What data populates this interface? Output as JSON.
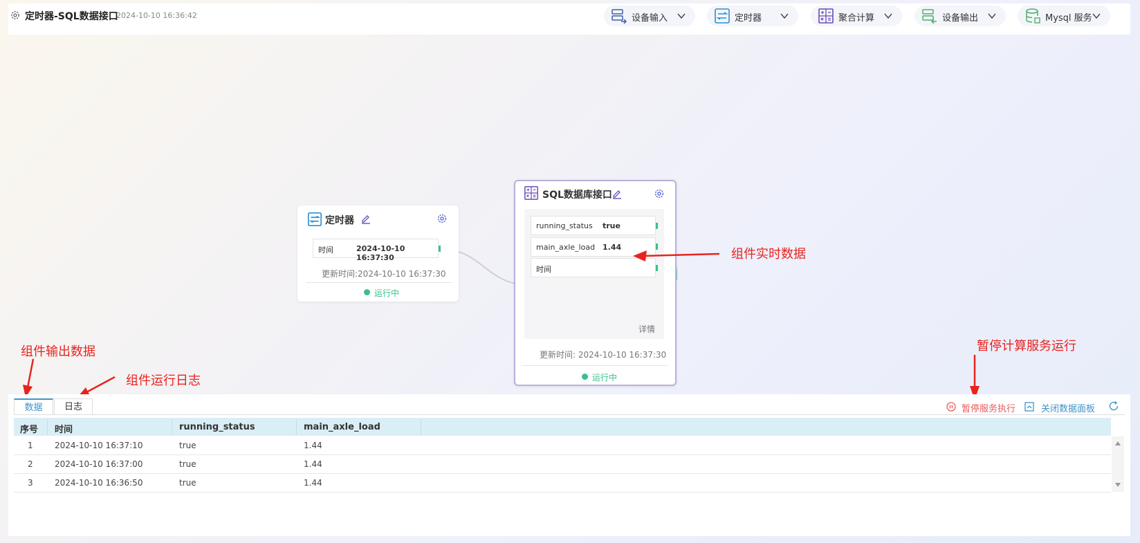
{
  "header": {
    "title": "定时器-SQL数据接口",
    "timestamp": "2024-10-10 16:36:42",
    "toolbar": [
      {
        "label": "设备输入",
        "icon": "device-input-icon"
      },
      {
        "label": "定时器",
        "icon": "timer-icon"
      },
      {
        "label": "聚合计算",
        "icon": "calc-icon"
      },
      {
        "label": "设备输出",
        "icon": "device-output-icon"
      },
      {
        "label": "Mysql 服务",
        "icon": "database-icon"
      }
    ]
  },
  "canvas": {
    "timer_node": {
      "title": "定时器",
      "field_label": "时间",
      "field_value": "2024-10-10 16:37:30",
      "updated": "更新时间:2024-10-10 16:37:30",
      "status": "运行中"
    },
    "sql_node": {
      "title": "SQL数据库接口",
      "fields": [
        {
          "key": "running_status",
          "value": "true"
        },
        {
          "key": "main_axle_load",
          "value": "1.44"
        },
        {
          "key": "时间",
          "value": ""
        }
      ],
      "details": "详情",
      "updated": "更新时间: 2024-10-10 16:37:30",
      "status": "运行中"
    }
  },
  "annotations": {
    "realtime": "组件实时数据",
    "output": "组件输出数据",
    "log": "组件运行日志",
    "pause": "暂停计算服务运行"
  },
  "panel": {
    "tabs": [
      "数据",
      "日志"
    ],
    "actions": {
      "pause": "暂停服务执行",
      "close": "关闭数据面板"
    },
    "colors": {
      "pause": "#e85a5a",
      "accent": "#3f93c7"
    },
    "columns": [
      "序号",
      "时间",
      "running_status",
      "main_axle_load"
    ],
    "rows": [
      [
        "1",
        "2024-10-10 16:37:10",
        "true",
        "1.44"
      ],
      [
        "2",
        "2024-10-10 16:37:00",
        "true",
        "1.44"
      ],
      [
        "3",
        "2024-10-10 16:36:50",
        "true",
        "1.44"
      ]
    ]
  }
}
